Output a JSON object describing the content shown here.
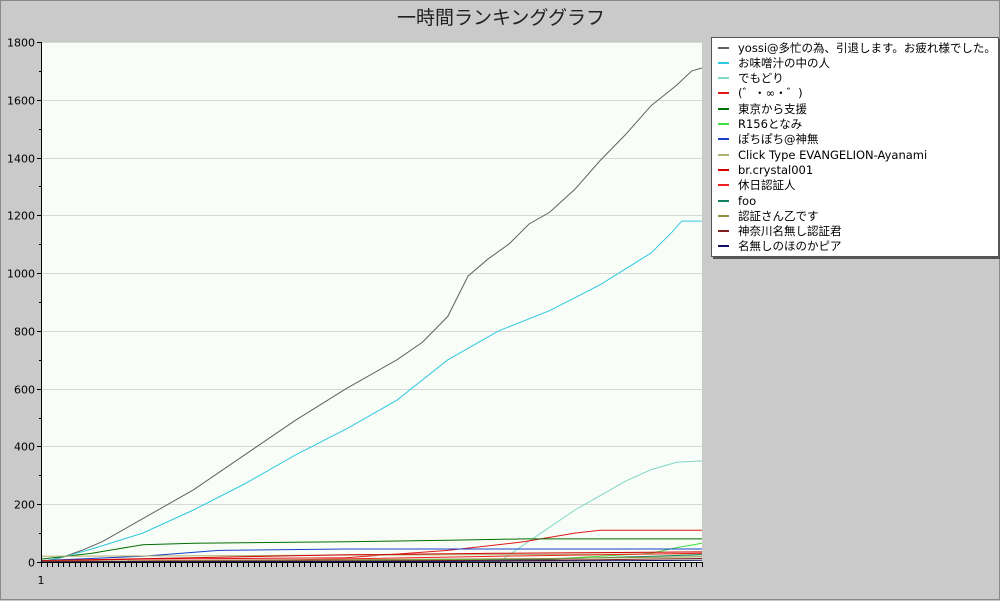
{
  "title": "一時間ランキンググラフ",
  "chart_data": {
    "type": "line",
    "title": "一時間ランキンググラフ",
    "xlabel": "",
    "ylabel": "",
    "ylim": [
      0,
      1800
    ],
    "yticks": [
      0,
      200,
      400,
      600,
      800,
      1000,
      1200,
      1400,
      1600,
      1800
    ],
    "xtick_label": "1",
    "x_steps": 118,
    "grid": true,
    "legend_position": "right",
    "series": [
      {
        "name": "yossi@多忙の為、引退します。お疲れ様でした。",
        "color": "#606060",
        "points": [
          [
            0,
            0
          ],
          [
            4,
            15
          ],
          [
            8,
            40
          ],
          [
            12,
            70
          ],
          [
            20,
            150
          ],
          [
            30,
            250
          ],
          [
            40,
            370
          ],
          [
            50,
            490
          ],
          [
            60,
            600
          ],
          [
            70,
            700
          ],
          [
            75,
            760
          ],
          [
            80,
            850
          ],
          [
            84,
            990
          ],
          [
            88,
            1050
          ],
          [
            92,
            1100
          ],
          [
            96,
            1170
          ],
          [
            100,
            1210
          ],
          [
            105,
            1290
          ],
          [
            110,
            1390
          ],
          [
            115,
            1480
          ],
          [
            120,
            1580
          ],
          [
            125,
            1650
          ],
          [
            128,
            1700
          ],
          [
            130,
            1710
          ]
        ]
      },
      {
        "name": "お味噌汁の中の人",
        "color": "#30c8e0",
        "points": [
          [
            0,
            0
          ],
          [
            5,
            20
          ],
          [
            10,
            45
          ],
          [
            20,
            100
          ],
          [
            30,
            180
          ],
          [
            40,
            270
          ],
          [
            50,
            370
          ],
          [
            60,
            460
          ],
          [
            70,
            560
          ],
          [
            80,
            700
          ],
          [
            90,
            800
          ],
          [
            100,
            870
          ],
          [
            110,
            960
          ],
          [
            120,
            1070
          ],
          [
            124,
            1140
          ],
          [
            126,
            1180
          ],
          [
            130,
            1180
          ]
        ]
      },
      {
        "name": "でもどり",
        "color": "#80d8c8",
        "points": [
          [
            0,
            0
          ],
          [
            90,
            0
          ],
          [
            95,
            60
          ],
          [
            100,
            120
          ],
          [
            105,
            180
          ],
          [
            110,
            230
          ],
          [
            115,
            280
          ],
          [
            120,
            320
          ],
          [
            125,
            345
          ],
          [
            130,
            350
          ]
        ]
      },
      {
        "name": "(゛・∞・゛)",
        "color": "#e01818",
        "points": [
          [
            0,
            5
          ],
          [
            20,
            10
          ],
          [
            60,
            15
          ],
          [
            80,
            40
          ],
          [
            95,
            70
          ],
          [
            100,
            85
          ],
          [
            105,
            100
          ],
          [
            110,
            110
          ],
          [
            130,
            110
          ]
        ]
      },
      {
        "name": "東京から支援",
        "color": "#007000",
        "points": [
          [
            0,
            10
          ],
          [
            5,
            20
          ],
          [
            10,
            30
          ],
          [
            15,
            45
          ],
          [
            20,
            60
          ],
          [
            30,
            65
          ],
          [
            60,
            70
          ],
          [
            80,
            75
          ],
          [
            95,
            80
          ],
          [
            130,
            80
          ]
        ]
      },
      {
        "name": "R156となみ",
        "color": "#40e040",
        "points": [
          [
            0,
            2
          ],
          [
            60,
            5
          ],
          [
            100,
            10
          ],
          [
            120,
            30
          ],
          [
            125,
            50
          ],
          [
            130,
            65
          ]
        ]
      },
      {
        "name": "ぽちぽち@神無",
        "color": "#1840c8",
        "points": [
          [
            0,
            5
          ],
          [
            20,
            20
          ],
          [
            35,
            40
          ],
          [
            60,
            45
          ],
          [
            90,
            45
          ],
          [
            130,
            45
          ]
        ]
      },
      {
        "name": "Click Type EVANGELION-Ayanami",
        "color": "#b0b070",
        "points": [
          [
            0,
            20
          ],
          [
            40,
            22
          ],
          [
            80,
            25
          ],
          [
            130,
            28
          ]
        ]
      },
      {
        "name": "br.crystal001",
        "color": "#d00000",
        "points": [
          [
            0,
            5
          ],
          [
            30,
            15
          ],
          [
            60,
            25
          ],
          [
            90,
            30
          ],
          [
            130,
            35
          ]
        ]
      },
      {
        "name": "休日認証人",
        "color": "#f02020",
        "points": [
          [
            0,
            2
          ],
          [
            50,
            8
          ],
          [
            90,
            20
          ],
          [
            130,
            30
          ]
        ]
      },
      {
        "name": "foo",
        "color": "#108060",
        "points": [
          [
            0,
            1
          ],
          [
            80,
            3
          ],
          [
            110,
            15
          ],
          [
            130,
            25
          ]
        ]
      },
      {
        "name": "認証さん乙です",
        "color": "#909040",
        "points": [
          [
            0,
            2
          ],
          [
            60,
            8
          ],
          [
            100,
            12
          ],
          [
            130,
            18
          ]
        ]
      },
      {
        "name": "神奈川名無し認証君",
        "color": "#802020",
        "points": [
          [
            0,
            1
          ],
          [
            70,
            4
          ],
          [
            110,
            8
          ],
          [
            130,
            12
          ]
        ]
      },
      {
        "name": "名無しのほのかピア",
        "color": "#101060",
        "points": [
          [
            0,
            0
          ],
          [
            80,
            2
          ],
          [
            130,
            6
          ]
        ]
      }
    ]
  }
}
